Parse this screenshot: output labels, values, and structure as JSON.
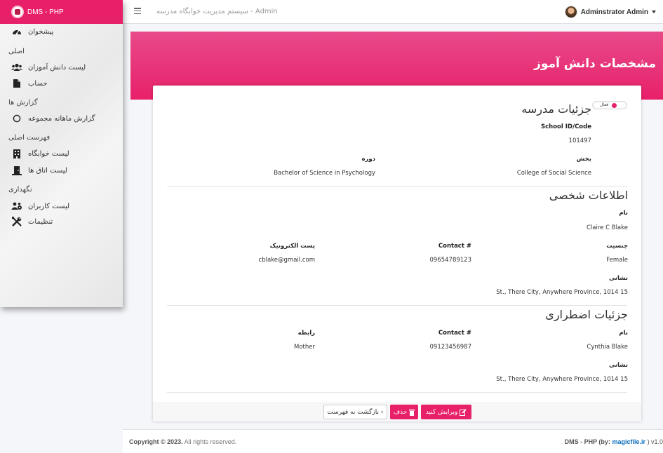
{
  "brand": {
    "name": "DMS - PHP"
  },
  "topbar": {
    "title": "سیستم مدیریت خوابگاه مدرسه - Admin",
    "user_name": "Adminstrator Admin"
  },
  "sidebar": {
    "items": [
      {
        "label": "پیشخوان",
        "icon": "dashboard-icon"
      },
      {
        "header": "اصلی"
      },
      {
        "label": "لیست دانش آموزان",
        "icon": "users-icon"
      },
      {
        "label": "حساب",
        "icon": "file-icon"
      },
      {
        "header": "گزارش ها"
      },
      {
        "label": "گزارش ماهانه مجموعه",
        "icon": "circle-icon"
      },
      {
        "header": "فهرست اصلی"
      },
      {
        "label": "لیست خوابگاه",
        "icon": "building-icon"
      },
      {
        "label": "لیست اتاق ها",
        "icon": "door-icon"
      },
      {
        "header": "نگهداری"
      },
      {
        "label": "لیست کاربران",
        "icon": "users-cog-icon"
      },
      {
        "label": "تنظیمات",
        "icon": "tools-icon"
      }
    ]
  },
  "page": {
    "title": "مشخصات دانش آموز"
  },
  "status_toggle": {
    "label": "فعال"
  },
  "school": {
    "title": "جزئیات مدرسه",
    "school_id_label": "School ID/Code",
    "school_id": "101497",
    "department_label": "بخش",
    "department": "College of Social Science",
    "course_label": "دوره",
    "course": "Bachelor of Science in Psychology"
  },
  "personal": {
    "title": "اطلاعات شخصی",
    "name_label": "نام",
    "name": "Claire C Blake",
    "gender_label": "جنسیت",
    "gender": "Female",
    "contact_label": "Contact #",
    "contact": "09654789123",
    "email_label": "پست الکترونیک",
    "email": "cblake@gmail.com",
    "address_label": "نشانی",
    "address": "St., There City, Anywhere Province, 1014 15"
  },
  "emergency": {
    "title": "جزئیات اضطراری",
    "name_label": "نام",
    "name": "Cynthia Blake",
    "contact_label": "Contact #",
    "contact": "09123456987",
    "relation_label": "رابطه",
    "relation": "Mother",
    "address_label": "نشانی",
    "address": "St., There City, Anywhere Province, 1014 15"
  },
  "actions": {
    "edit": "ویرایش کنید",
    "delete": "حذف",
    "back": "بازگشت به فهرست"
  },
  "footer": {
    "copyright": "Copyright © 2023.",
    "rights": "All rights reserved.",
    "version_prefix": "DMS - PHP (by:",
    "link": "magicfile.ir",
    "version_suffix": ") v1.0"
  },
  "colors": {
    "accent": "#e8206a"
  }
}
